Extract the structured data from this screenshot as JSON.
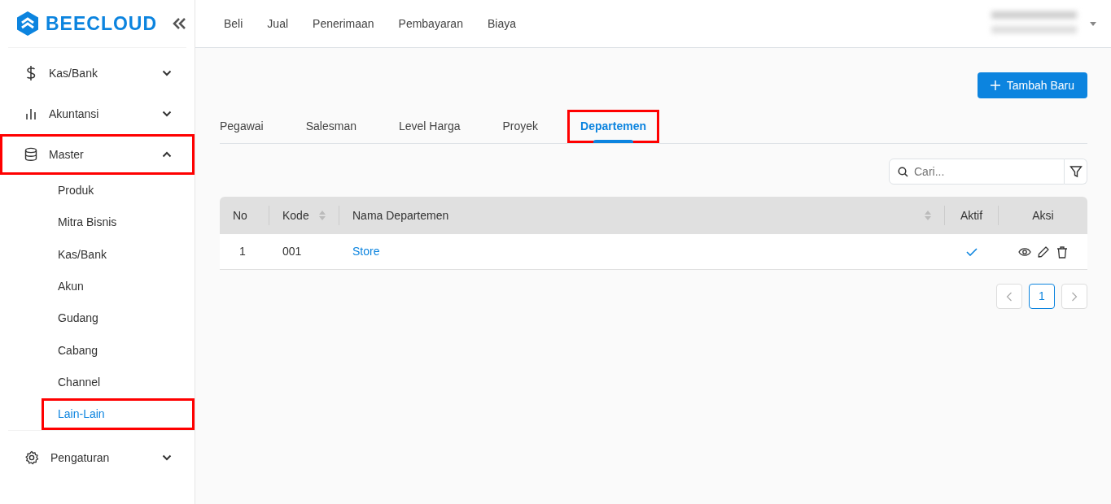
{
  "logo": {
    "text": "BEECLOUD"
  },
  "sidebar": {
    "items": [
      {
        "label": "Kas/Bank",
        "expanded": false,
        "highlighted": false
      },
      {
        "label": "Akuntansi",
        "expanded": false,
        "highlighted": false
      },
      {
        "label": "Master",
        "expanded": true,
        "highlighted": true,
        "children": [
          {
            "label": "Produk",
            "selected": false,
            "highlighted": false
          },
          {
            "label": "Mitra Bisnis",
            "selected": false,
            "highlighted": false
          },
          {
            "label": "Kas/Bank",
            "selected": false,
            "highlighted": false
          },
          {
            "label": "Akun",
            "selected": false,
            "highlighted": false
          },
          {
            "label": "Gudang",
            "selected": false,
            "highlighted": false
          },
          {
            "label": "Cabang",
            "selected": false,
            "highlighted": false
          },
          {
            "label": "Channel",
            "selected": false,
            "highlighted": false
          },
          {
            "label": "Lain-Lain",
            "selected": true,
            "highlighted": true
          }
        ]
      },
      {
        "label": "Pengaturan",
        "expanded": false,
        "highlighted": false
      }
    ]
  },
  "top_nav": [
    "Beli",
    "Jual",
    "Penerimaan",
    "Pembayaran",
    "Biaya"
  ],
  "add_button": "Tambah Baru",
  "tabs": [
    {
      "label": "Pegawai",
      "selected": false,
      "highlighted": false
    },
    {
      "label": "Salesman",
      "selected": false,
      "highlighted": false
    },
    {
      "label": "Level Harga",
      "selected": false,
      "highlighted": false
    },
    {
      "label": "Proyek",
      "selected": false,
      "highlighted": false
    },
    {
      "label": "Departemen",
      "selected": true,
      "highlighted": true
    }
  ],
  "search": {
    "placeholder": "Cari..."
  },
  "table": {
    "columns": [
      {
        "label": "No",
        "sortable": false
      },
      {
        "label": "Kode",
        "sortable": true
      },
      {
        "label": "Nama Departemen",
        "sortable": true
      },
      {
        "label": "Aktif",
        "sortable": false
      },
      {
        "label": "Aksi",
        "sortable": false
      }
    ],
    "rows": [
      {
        "no": "1",
        "kode": "001",
        "nama": "Store",
        "aktif": true
      }
    ]
  },
  "pagination": {
    "pages": [
      {
        "label": "1",
        "selected": true
      }
    ]
  }
}
